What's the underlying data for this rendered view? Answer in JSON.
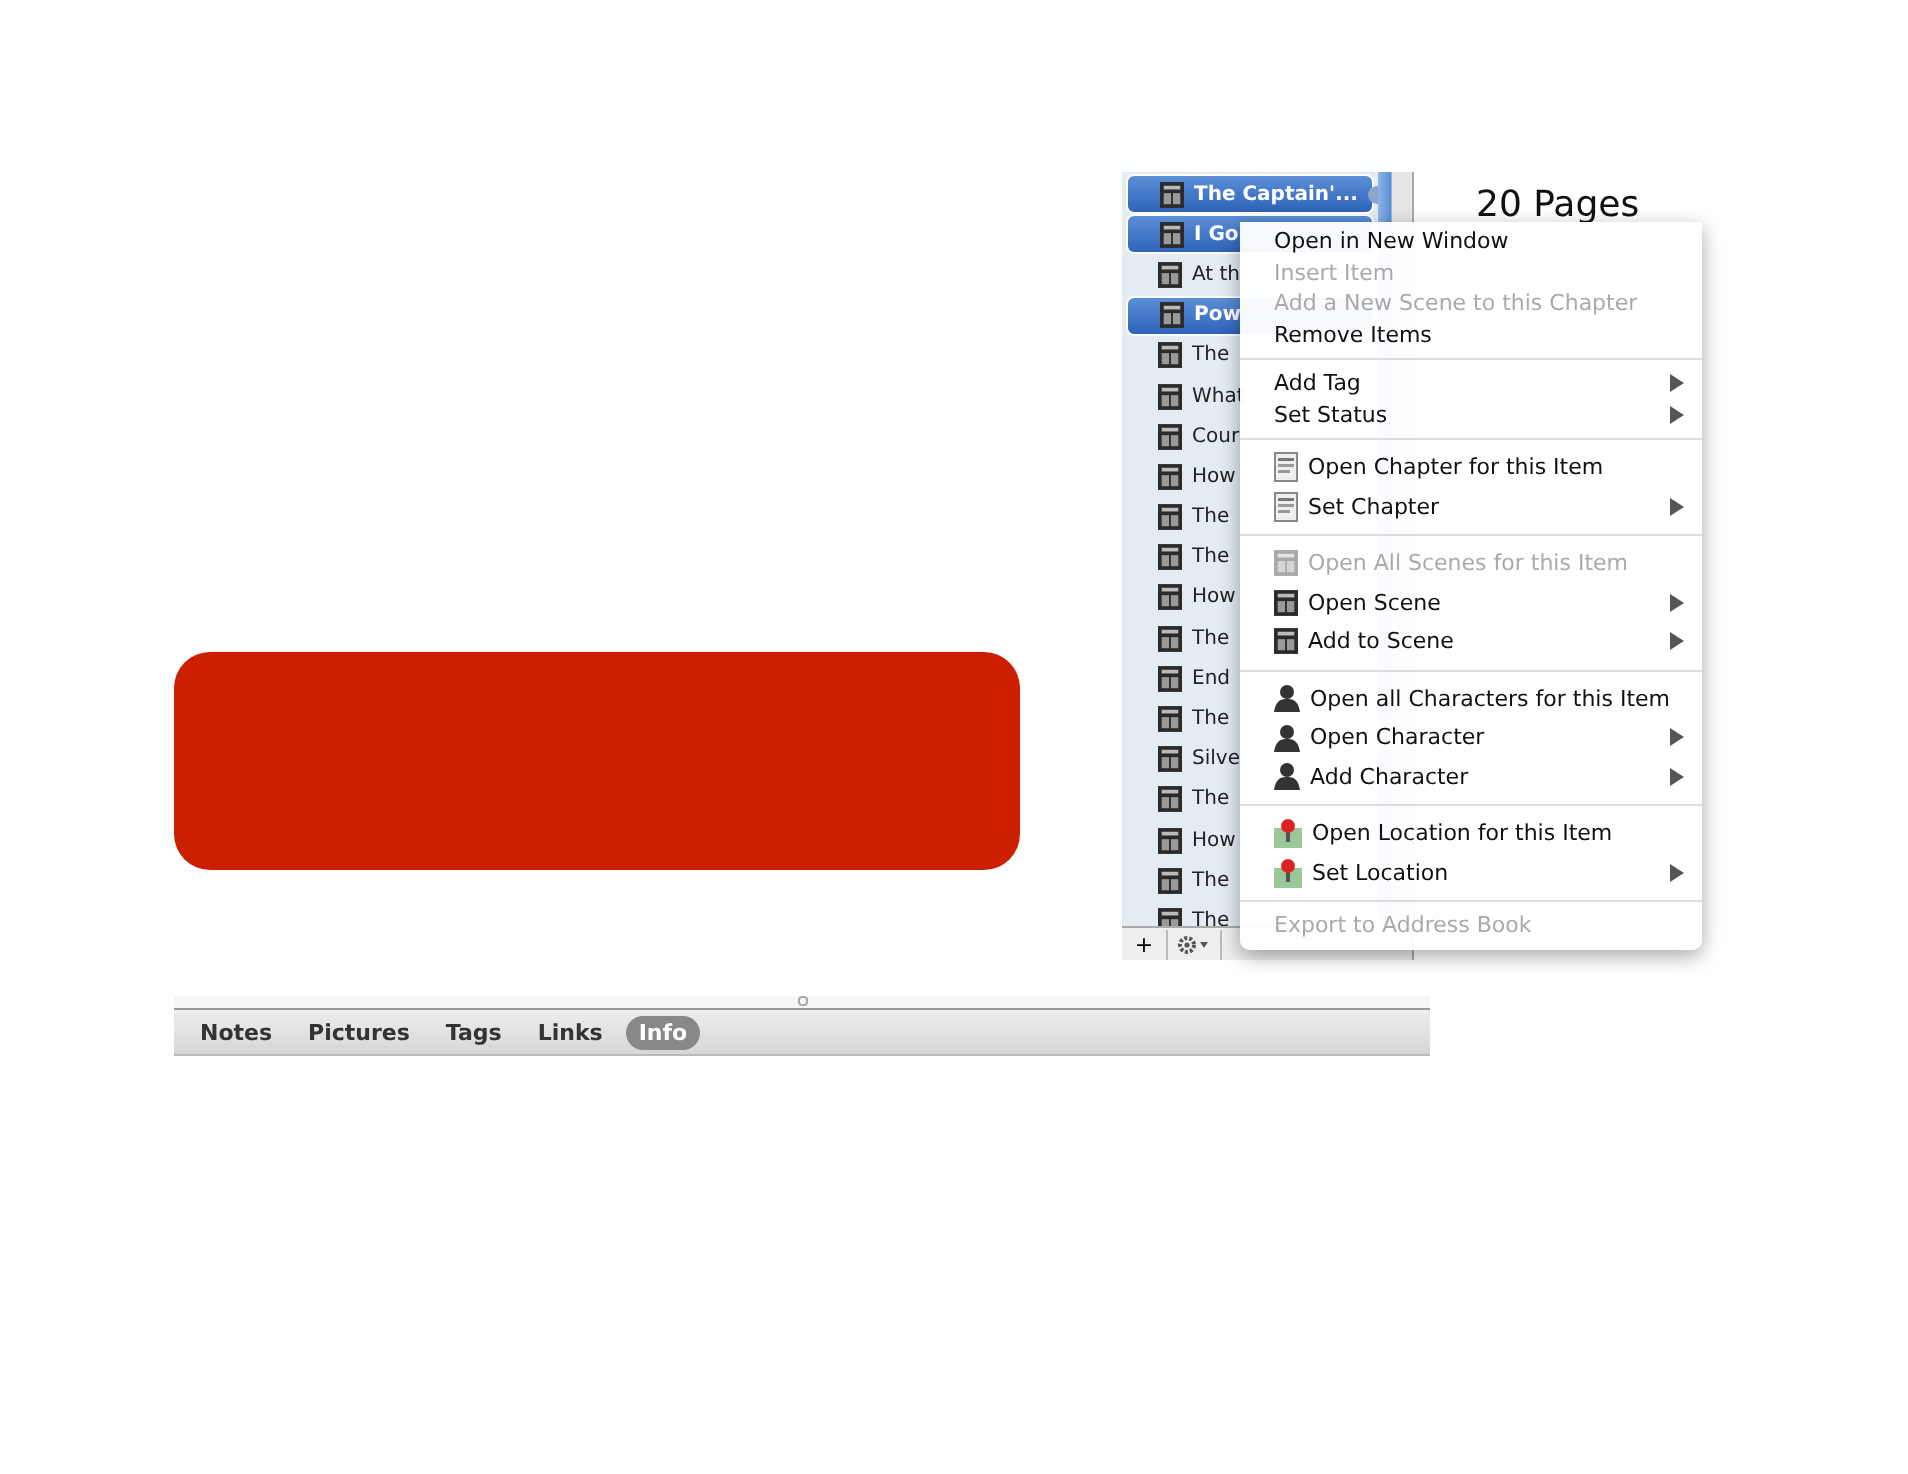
{
  "binder": {
    "items": [
      {
        "title": "The Captain'...",
        "selected": true,
        "badge": true
      },
      {
        "title": "I Go",
        "selected": true
      },
      {
        "title": "At th",
        "selected": false
      },
      {
        "title": "Pow",
        "selected": true
      },
      {
        "title": "The",
        "selected": false
      },
      {
        "title": "What",
        "selected": false
      },
      {
        "title": "Cour",
        "selected": false
      },
      {
        "title": "How",
        "selected": false
      },
      {
        "title": "The",
        "selected": false
      },
      {
        "title": "The",
        "selected": false
      },
      {
        "title": "How",
        "selected": false
      },
      {
        "title": "The",
        "selected": false
      },
      {
        "title": "End",
        "selected": false
      },
      {
        "title": "The",
        "selected": false
      },
      {
        "title": "Silve",
        "selected": false
      },
      {
        "title": "The",
        "selected": false
      },
      {
        "title": "How",
        "selected": false
      },
      {
        "title": "The",
        "selected": false
      },
      {
        "title": "The",
        "selected": false
      }
    ],
    "toolbar": [
      {
        "label": "+"
      }
    ]
  },
  "info": {
    "pages": "20 Pages"
  },
  "context_menu": [
    {
      "kind": "plain",
      "label": "Open in New Window",
      "disabled": false,
      "submenu": false
    },
    {
      "kind": "plain",
      "label": "Insert Item",
      "disabled": true,
      "submenu": false
    },
    {
      "kind": "plain",
      "label": "Add a New Scene to this Chapter",
      "disabled": true,
      "submenu": false
    },
    {
      "kind": "plain",
      "label": "Remove Items",
      "disabled": false,
      "submenu": false
    },
    {
      "kind": "separator"
    },
    {
      "kind": "plain",
      "label": "Add Tag",
      "disabled": false,
      "submenu": true
    },
    {
      "kind": "plain",
      "label": "Set Status",
      "disabled": false,
      "submenu": true
    },
    {
      "kind": "separator"
    },
    {
      "kind": "chapter",
      "label": "Open Chapter for this Item",
      "disabled": false,
      "submenu": false
    },
    {
      "kind": "chapter",
      "label": "Set Chapter",
      "disabled": false,
      "submenu": true
    },
    {
      "kind": "separator"
    },
    {
      "kind": "scene",
      "label": "Open All Scenes for this Item",
      "disabled": true,
      "submenu": false
    },
    {
      "kind": "scene",
      "label": "Open Scene",
      "disabled": false,
      "submenu": true
    },
    {
      "kind": "scene",
      "label": "Add to Scene",
      "disabled": false,
      "submenu": true
    },
    {
      "kind": "separator"
    },
    {
      "kind": "character",
      "label": "Open all Characters for this Item",
      "disabled": false,
      "submenu": false
    },
    {
      "kind": "character",
      "label": "Open Character",
      "disabled": false,
      "submenu": true
    },
    {
      "kind": "character",
      "label": "Add Character",
      "disabled": false,
      "submenu": true
    },
    {
      "kind": "separator"
    },
    {
      "kind": "location",
      "label": "Open Location for this Item",
      "disabled": false,
      "submenu": false
    },
    {
      "kind": "location",
      "label": "Set Location",
      "disabled": false,
      "submenu": true
    },
    {
      "kind": "separator"
    },
    {
      "kind": "plain",
      "label": "Export to Address Book",
      "disabled": true,
      "submenu": false
    }
  ],
  "bottom_tabs": [
    {
      "label": "Notes",
      "selected": false
    },
    {
      "label": "Pictures",
      "selected": false
    },
    {
      "label": "Tags",
      "selected": false
    },
    {
      "label": "Links",
      "selected": false
    },
    {
      "label": "Info",
      "selected": true
    }
  ]
}
